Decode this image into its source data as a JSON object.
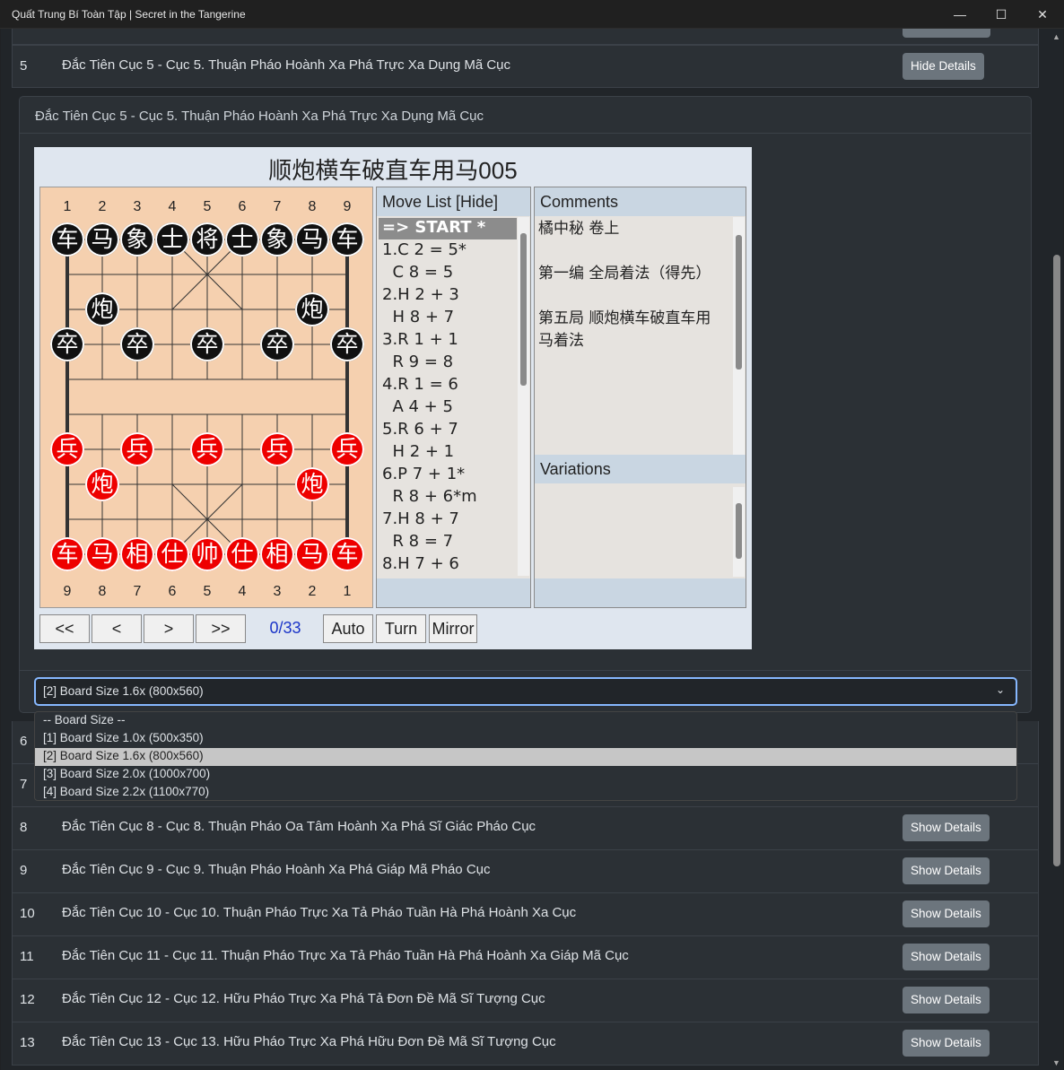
{
  "window": {
    "title": "Quất Trung Bí Toàn Tập | Secret in the Tangerine",
    "minimize": "—",
    "maximize": "☐",
    "close": "✕"
  },
  "rows": [
    {
      "num": "5",
      "title": "Đắc Tiên Cục 5 - Cục 5. Thuận Pháo Hoành Xa Phá Trực Xa Dụng Mã Cục",
      "button": "Hide Details"
    },
    {
      "num": "6",
      "title": "",
      "button": ""
    },
    {
      "num": "7",
      "title": "",
      "button": ""
    },
    {
      "num": "8",
      "title": "Đắc Tiên Cục 8 - Cục 8. Thuận Pháo Oa Tâm Hoành Xa Phá Sĩ Giác Pháo Cục",
      "button": "Show Details"
    },
    {
      "num": "9",
      "title": "Đắc Tiên Cục 9 - Cục 9. Thuận Pháo Hoành Xa Phá Giáp Mã Pháo Cục",
      "button": "Show Details"
    },
    {
      "num": "10",
      "title": "Đắc Tiên Cục 10 - Cục 10. Thuận Pháo Trực Xa Tả Pháo Tuần Hà Phá Hoành Xa Cục",
      "button": "Show Details"
    },
    {
      "num": "11",
      "title": "Đắc Tiên Cục 11 - Cục 11. Thuận Pháo Trực Xa Tả Pháo Tuần Hà Phá Hoành Xa Giáp Mã Cục",
      "button": "Show Details"
    },
    {
      "num": "12",
      "title": "Đắc Tiên Cục 12 - Cục 12. Hữu Pháo Trực Xa Phá Tả Đơn Đề Mã Sĩ Tượng Cục",
      "button": "Show Details"
    },
    {
      "num": "13",
      "title": "Đắc Tiên Cục 13 - Cục 13. Hữu Pháo Trực Xa Phá Hữu Đơn Đề Mã Sĩ Tượng Cục",
      "button": "Show Details"
    }
  ],
  "detail": {
    "header": "Đắc Tiên Cục 5 - Cục 5. Thuận Pháo Hoành Xa Phá Trực Xa Dụng Mã Cục"
  },
  "board": {
    "title": "顺炮横车破直车用马005",
    "top_coords": [
      "1",
      "2",
      "3",
      "4",
      "5",
      "6",
      "7",
      "8",
      "9"
    ],
    "bottom_coords": [
      "9",
      "8",
      "7",
      "6",
      "5",
      "4",
      "3",
      "2",
      "1"
    ],
    "black_back": [
      "车",
      "马",
      "象",
      "士",
      "将",
      "士",
      "象",
      "马",
      "车"
    ],
    "black_cannon": "炮",
    "black_pawn": "卒",
    "red_back": [
      "车",
      "马",
      "相",
      "仕",
      "帅",
      "仕",
      "相",
      "马",
      "车"
    ],
    "red_cannon": "炮",
    "red_pawn": "兵"
  },
  "movelist": {
    "header": "Move List [Hide]",
    "moves": [
      "=> START *",
      "1.C 2 = 5*",
      "  C 8 = 5",
      "2.H 2 + 3",
      "  H 8 + 7",
      "3.R 1 + 1",
      "  R 9 = 8",
      "4.R 1 = 6",
      "  A 4 + 5",
      "5.R 6 + 7",
      "  H 2 + 1",
      "6.P 7 + 1*",
      "  R 8 + 6*m",
      "7.H 8 + 7",
      "  R 8 = 7",
      "8.H 7 + 6"
    ]
  },
  "comments": {
    "header": "Comments",
    "lines": [
      "橘中秘 卷上",
      "",
      "第一编 全局着法（得先）",
      "",
      "第五局 顺炮横车破直车用",
      "马着法"
    ]
  },
  "variations": {
    "header": "Variations"
  },
  "controls": {
    "first": "<<",
    "prev": "<",
    "next": ">",
    "last": ">>",
    "counter": "0/33",
    "auto": "Auto",
    "turn": "Turn",
    "mirror": "Mirror"
  },
  "board_size": {
    "selected": "[2] Board Size 1.6x (800x560)",
    "options": [
      "-- Board Size --",
      "[1] Board Size 1.0x (500x350)",
      "[2] Board Size 1.6x (800x560)",
      "[3] Board Size 2.0x (1000x700)",
      "[4] Board Size 2.2x (1100x770)"
    ]
  }
}
